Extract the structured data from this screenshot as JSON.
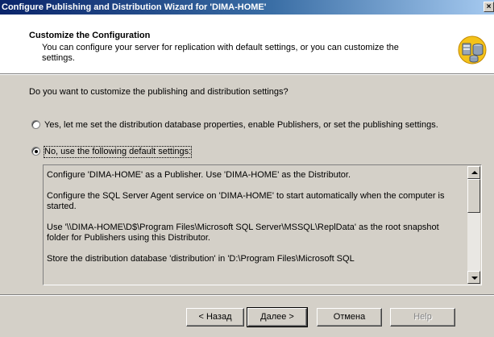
{
  "window": {
    "title": "Configure Publishing and Distribution Wizard for 'DIMA-HOME'",
    "close_glyph": "×"
  },
  "header": {
    "title": "Customize the Configuration",
    "subtitle": "You can configure your server for replication with default settings, or you can customize the settings.",
    "icon": "server-replication-icon"
  },
  "question": "Do you want to customize the publishing and distribution settings?",
  "options": [
    {
      "label": "Yes, let me set the distribution database properties, enable Publishers, or set the publishing settings.",
      "selected": false
    },
    {
      "label": "No, use the following default settings:",
      "selected": true
    }
  ],
  "settings_text": [
    "Configure 'DIMA-HOME' as a Publisher. Use 'DIMA-HOME' as the Distributor.",
    "Configure the SQL Server Agent service on 'DIMA-HOME' to start automatically when the computer is started.",
    "Use '\\\\DIMA-HOME\\D$\\Program Files\\Microsoft SQL Server\\MSSQL\\ReplData' as the root snapshot folder for Publishers using this Distributor.",
    "Store the distribution database 'distribution' in 'D:\\Program Files\\Microsoft SQL"
  ],
  "buttons": {
    "back": "< Назад",
    "next": "Далее >",
    "cancel": "Отмена",
    "help": "Help"
  }
}
